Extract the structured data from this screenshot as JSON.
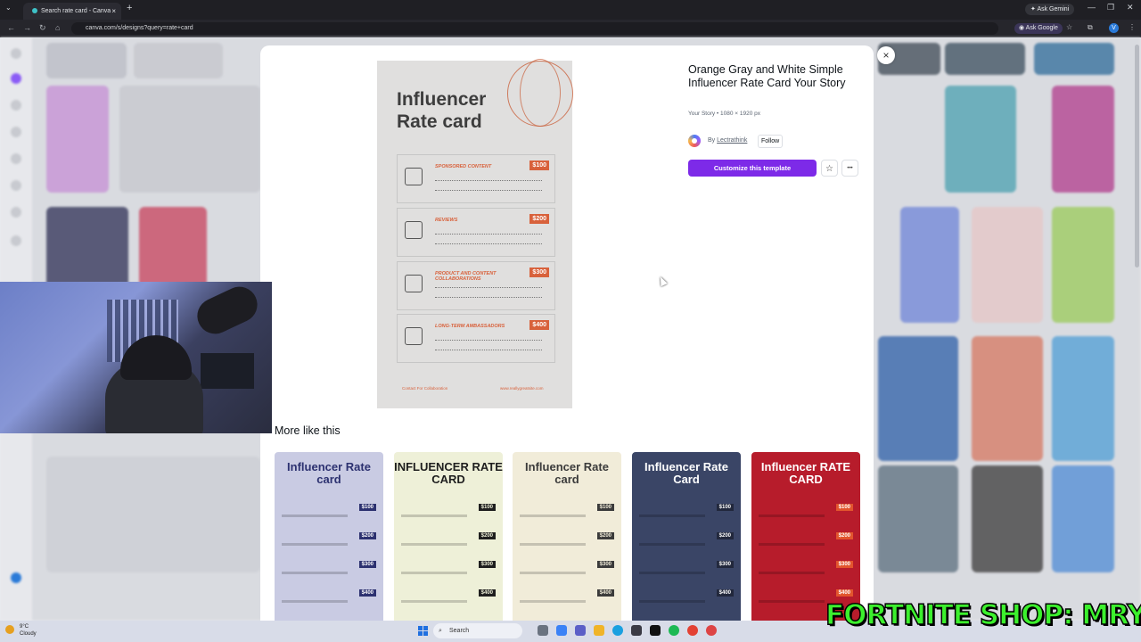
{
  "browser": {
    "tab_title": "Search rate card - Canva",
    "tab_close": "×",
    "new_tab": "+",
    "ask_gemini": "Ask Gemini",
    "url": "canva.com/s/designs?query=rate+card",
    "ask_google": "Ask Google",
    "profile_initial": "V"
  },
  "modal": {
    "close": "×",
    "template_title": "Orange Gray and White Simple Influencer Rate Card Your Story",
    "meta": "Your Story • 1080 × 1920 px",
    "by_prefix": "By",
    "author": "Lectrathink",
    "follow": "Follow",
    "customize": "Customize this template",
    "star": "☆",
    "more_options": "•••",
    "more_like_this": "More like this"
  },
  "preview": {
    "title": "Influencer Rate card",
    "rows": [
      {
        "label": "SPONSORED CONTENT",
        "price": "$100"
      },
      {
        "label": "REVIEWS",
        "price": "$200"
      },
      {
        "label": "PRODUCT AND CONTENT COLLABORATIONS",
        "price": "$300"
      },
      {
        "label": "LONG-TERM AMBASSADORS",
        "price": "$400"
      }
    ],
    "footer_left": "Contact For Collaboration",
    "footer_right": "www.reallygreatsite.com"
  },
  "similar": [
    {
      "title": "Influencer Rate card",
      "prices": [
        "$100",
        "$200",
        "$300",
        "$400"
      ],
      "bg": "#c9cbe3",
      "fg": "#2c3170",
      "pricebg": "#2c3170",
      "pricefg": "#ffffff"
    },
    {
      "title": "INFLUENCER RATE CARD",
      "prices": [
        "$100",
        "$200",
        "$300",
        "$400"
      ],
      "bg": "#eef0d8",
      "fg": "#1e1e1e",
      "pricebg": "#1e1e1e",
      "pricefg": "#eef0d8"
    },
    {
      "title": "Influencer Rate card",
      "prices": [
        "$100",
        "$200",
        "$300",
        "$400"
      ],
      "bg": "#f1ecd9",
      "fg": "#3b3b3b",
      "pricebg": "#3b3b3b",
      "pricefg": "#f1ecd9"
    },
    {
      "title": "Influencer Rate Card",
      "prices": [
        "$100",
        "$200",
        "$300",
        "$400"
      ],
      "bg": "#3a4566",
      "fg": "#ffffff",
      "pricebg": "#22283c",
      "pricefg": "#ffffff"
    },
    {
      "title": "Influencer RATE CARD",
      "prices": [
        "$100",
        "$200",
        "$300",
        "$400"
      ],
      "bg": "#b71c2b",
      "fg": "#ffffff",
      "pricebg": "#e2552d",
      "pricefg": "#ffffff"
    }
  ],
  "taskbar": {
    "temp": "9°C",
    "weather": "Cloudy",
    "search": "Search"
  },
  "overlay": {
    "text": "FORTNITE SHOP: MRYAS"
  }
}
